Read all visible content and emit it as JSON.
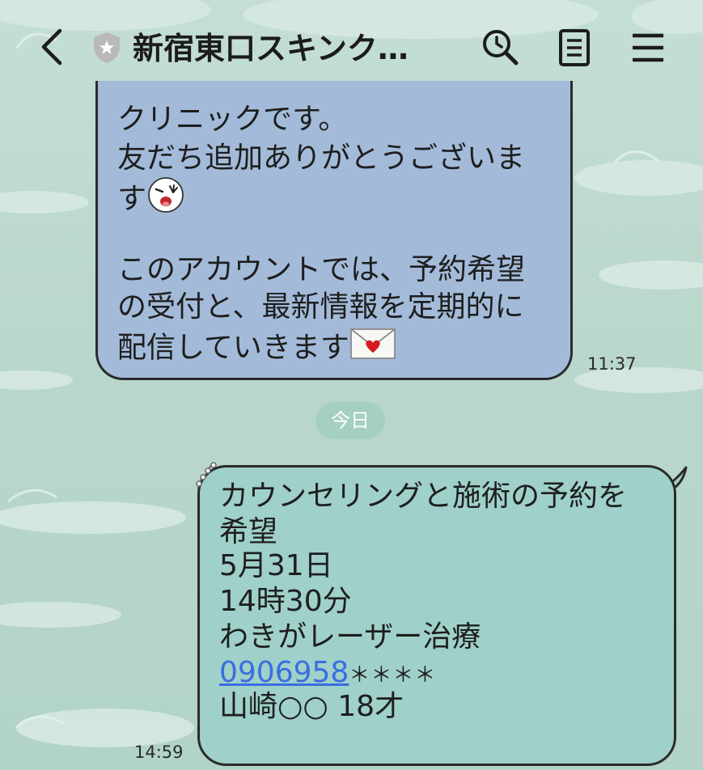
{
  "header": {
    "title": "新宿東口スキンク…",
    "back_icon": "chevron-left-icon",
    "shield_icon": "shield-star-icon",
    "search_icon": "search-icon",
    "notes_icon": "notes-icon",
    "menu_icon": "hamburger-menu-icon"
  },
  "incoming_message": {
    "lines": [
      "クリニックです。",
      "友だち追加ありがとうございま",
      "す",
      "",
      "このアカウントでは、予約希望",
      "の受付と、最新情報を定期的に",
      "配信していきます"
    ],
    "emoji_1": "wink-face-sticker-icon",
    "emoji_2": "heart-envelope-icon",
    "time": "11:37",
    "bubble_color": "#a3bbd9"
  },
  "date_separator": "今日",
  "outgoing_message": {
    "lines": [
      "カウンセリングと施術の予約を",
      "希望",
      "5月31日",
      "14時30分",
      "わきがレーザー治療"
    ],
    "phone_link": "0906958",
    "phone_masked": "＊＊＊＊",
    "name_line": "山崎○○ 18才",
    "time": "14:59",
    "bubble_color": "#9fd0c9",
    "link_color": "#3a6ee0"
  }
}
